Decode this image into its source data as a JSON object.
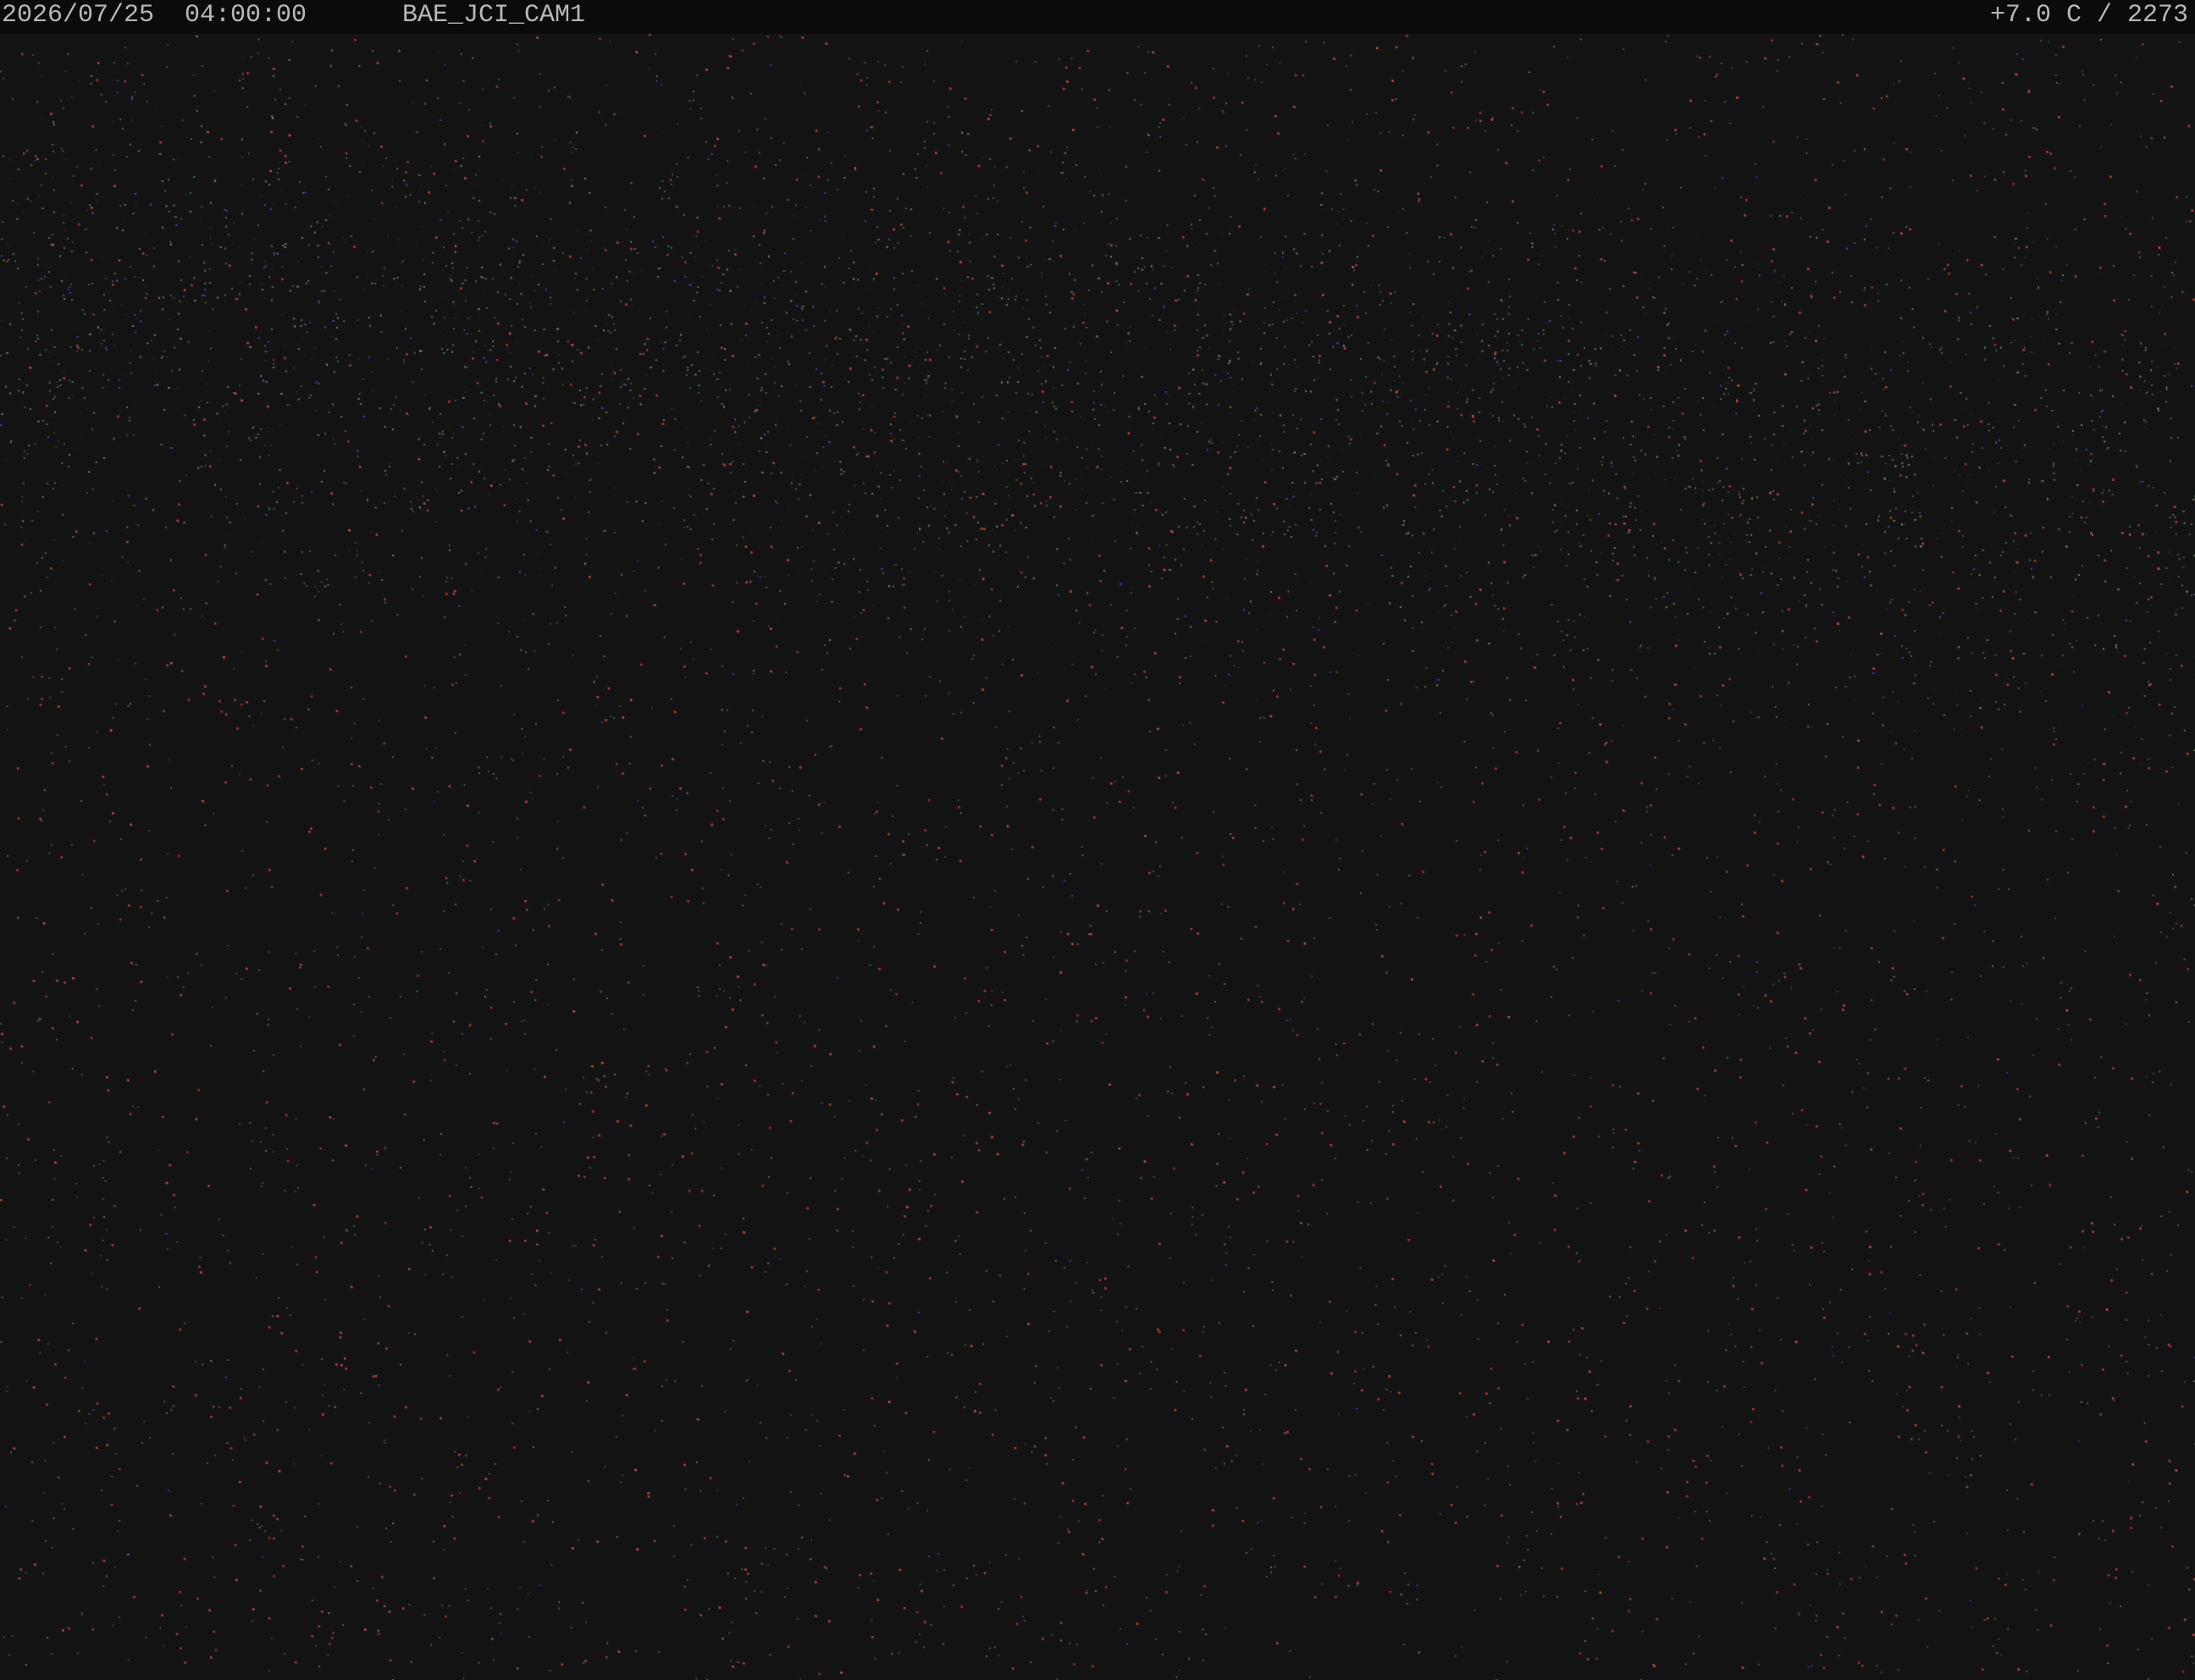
{
  "overlay": {
    "timestamp": "2026/07/25  04:00:00",
    "camera_id": "BAE_JCI_CAM1",
    "temperature": "+7.0 C / 2273"
  },
  "scene": {
    "background_color": "#131313",
    "star_colors": [
      "#c84040",
      "#b83838",
      "#d04848",
      "#6a6a58",
      "#5a5a50",
      "#4a7050",
      "#4a4a90",
      "#7a7a68"
    ]
  }
}
